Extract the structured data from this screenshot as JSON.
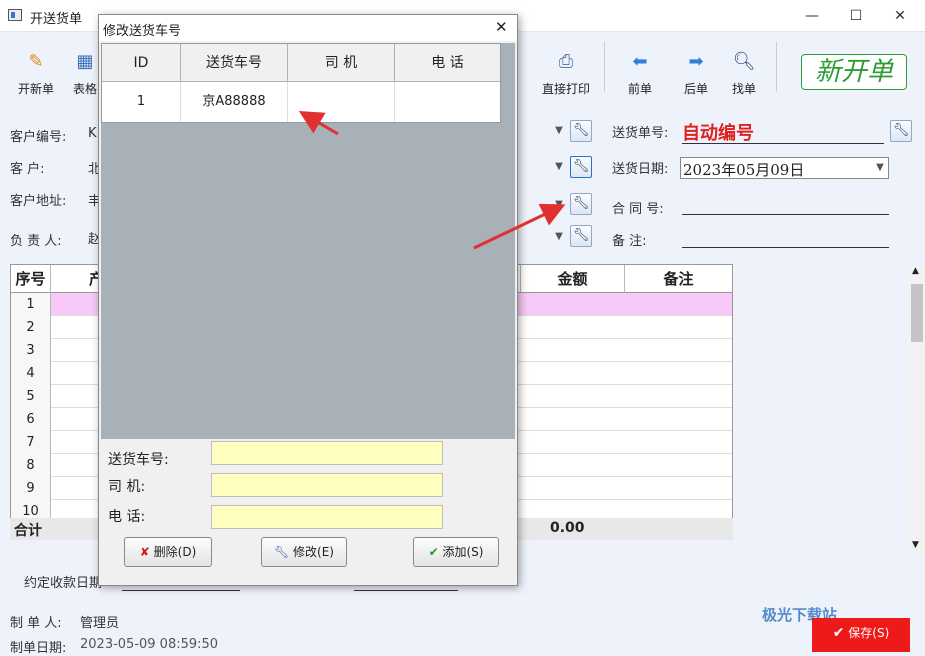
{
  "window": {
    "title": "开送货单",
    "minimize": "—",
    "maximize": "☐",
    "close": "✕"
  },
  "toolbar": {
    "new_label": "开新单",
    "table_label": "表格",
    "print_label": "直接打印",
    "prev_label": "前单",
    "next_label": "后单",
    "find_label": "找单",
    "new_bill_stamp": "新开单"
  },
  "form": {
    "customer_code_label": "客户编号:",
    "customer_code_value": "K",
    "customer_label": "客    户:",
    "customer_value": "北",
    "address_label": "客户地址:",
    "address_value": "丰",
    "manager_label": "负 责 人:",
    "manager_value": "赵",
    "delivery_no_label": "送货单号:",
    "delivery_no_value": "自动编号",
    "delivery_date_label": "送货日期:",
    "delivery_date_value": "2023年05月09日",
    "contract_label": "合 同 号:",
    "contract_value": "",
    "remark_label": "备    注:",
    "remark_value": ""
  },
  "grid": {
    "headers": [
      "序号",
      "产",
      "金额",
      "备注"
    ],
    "rows": [
      "1",
      "2",
      "3",
      "4",
      "5",
      "6",
      "7",
      "8",
      "9",
      "10"
    ],
    "total_label": "合计",
    "total_amount": "0.00"
  },
  "footer": {
    "due_date_label": "约定收款日期",
    "creator_label": "制 单 人:",
    "creator_value": "管理员",
    "created_label": "制单日期:",
    "created_value": "2023-05-09 08:59:50",
    "save_label": "保存(S)"
  },
  "dialog": {
    "title": "修改送货车号",
    "close": "✕",
    "columns": [
      "ID",
      "送货车号",
      "司    机",
      "电    话"
    ],
    "rows": [
      {
        "id": "1",
        "plate": "京A88888",
        "driver": "",
        "phone": ""
      }
    ],
    "plate_label": "送货车号:",
    "driver_label": "司    机:",
    "phone_label": "电    话:",
    "plate_value": "",
    "driver_value": "",
    "phone_value": "",
    "delete_label": "删除(D)",
    "edit_label": "修改(E)",
    "add_label": "添加(S)"
  },
  "colors": {
    "highlight_row": "#f8c8f8",
    "stamp_green": "#2b9d2f",
    "auto_number_red": "#e01f1f",
    "input_yellow": "#ffffc0",
    "arrow_red": "#e03030"
  },
  "watermark": "极光下载站"
}
